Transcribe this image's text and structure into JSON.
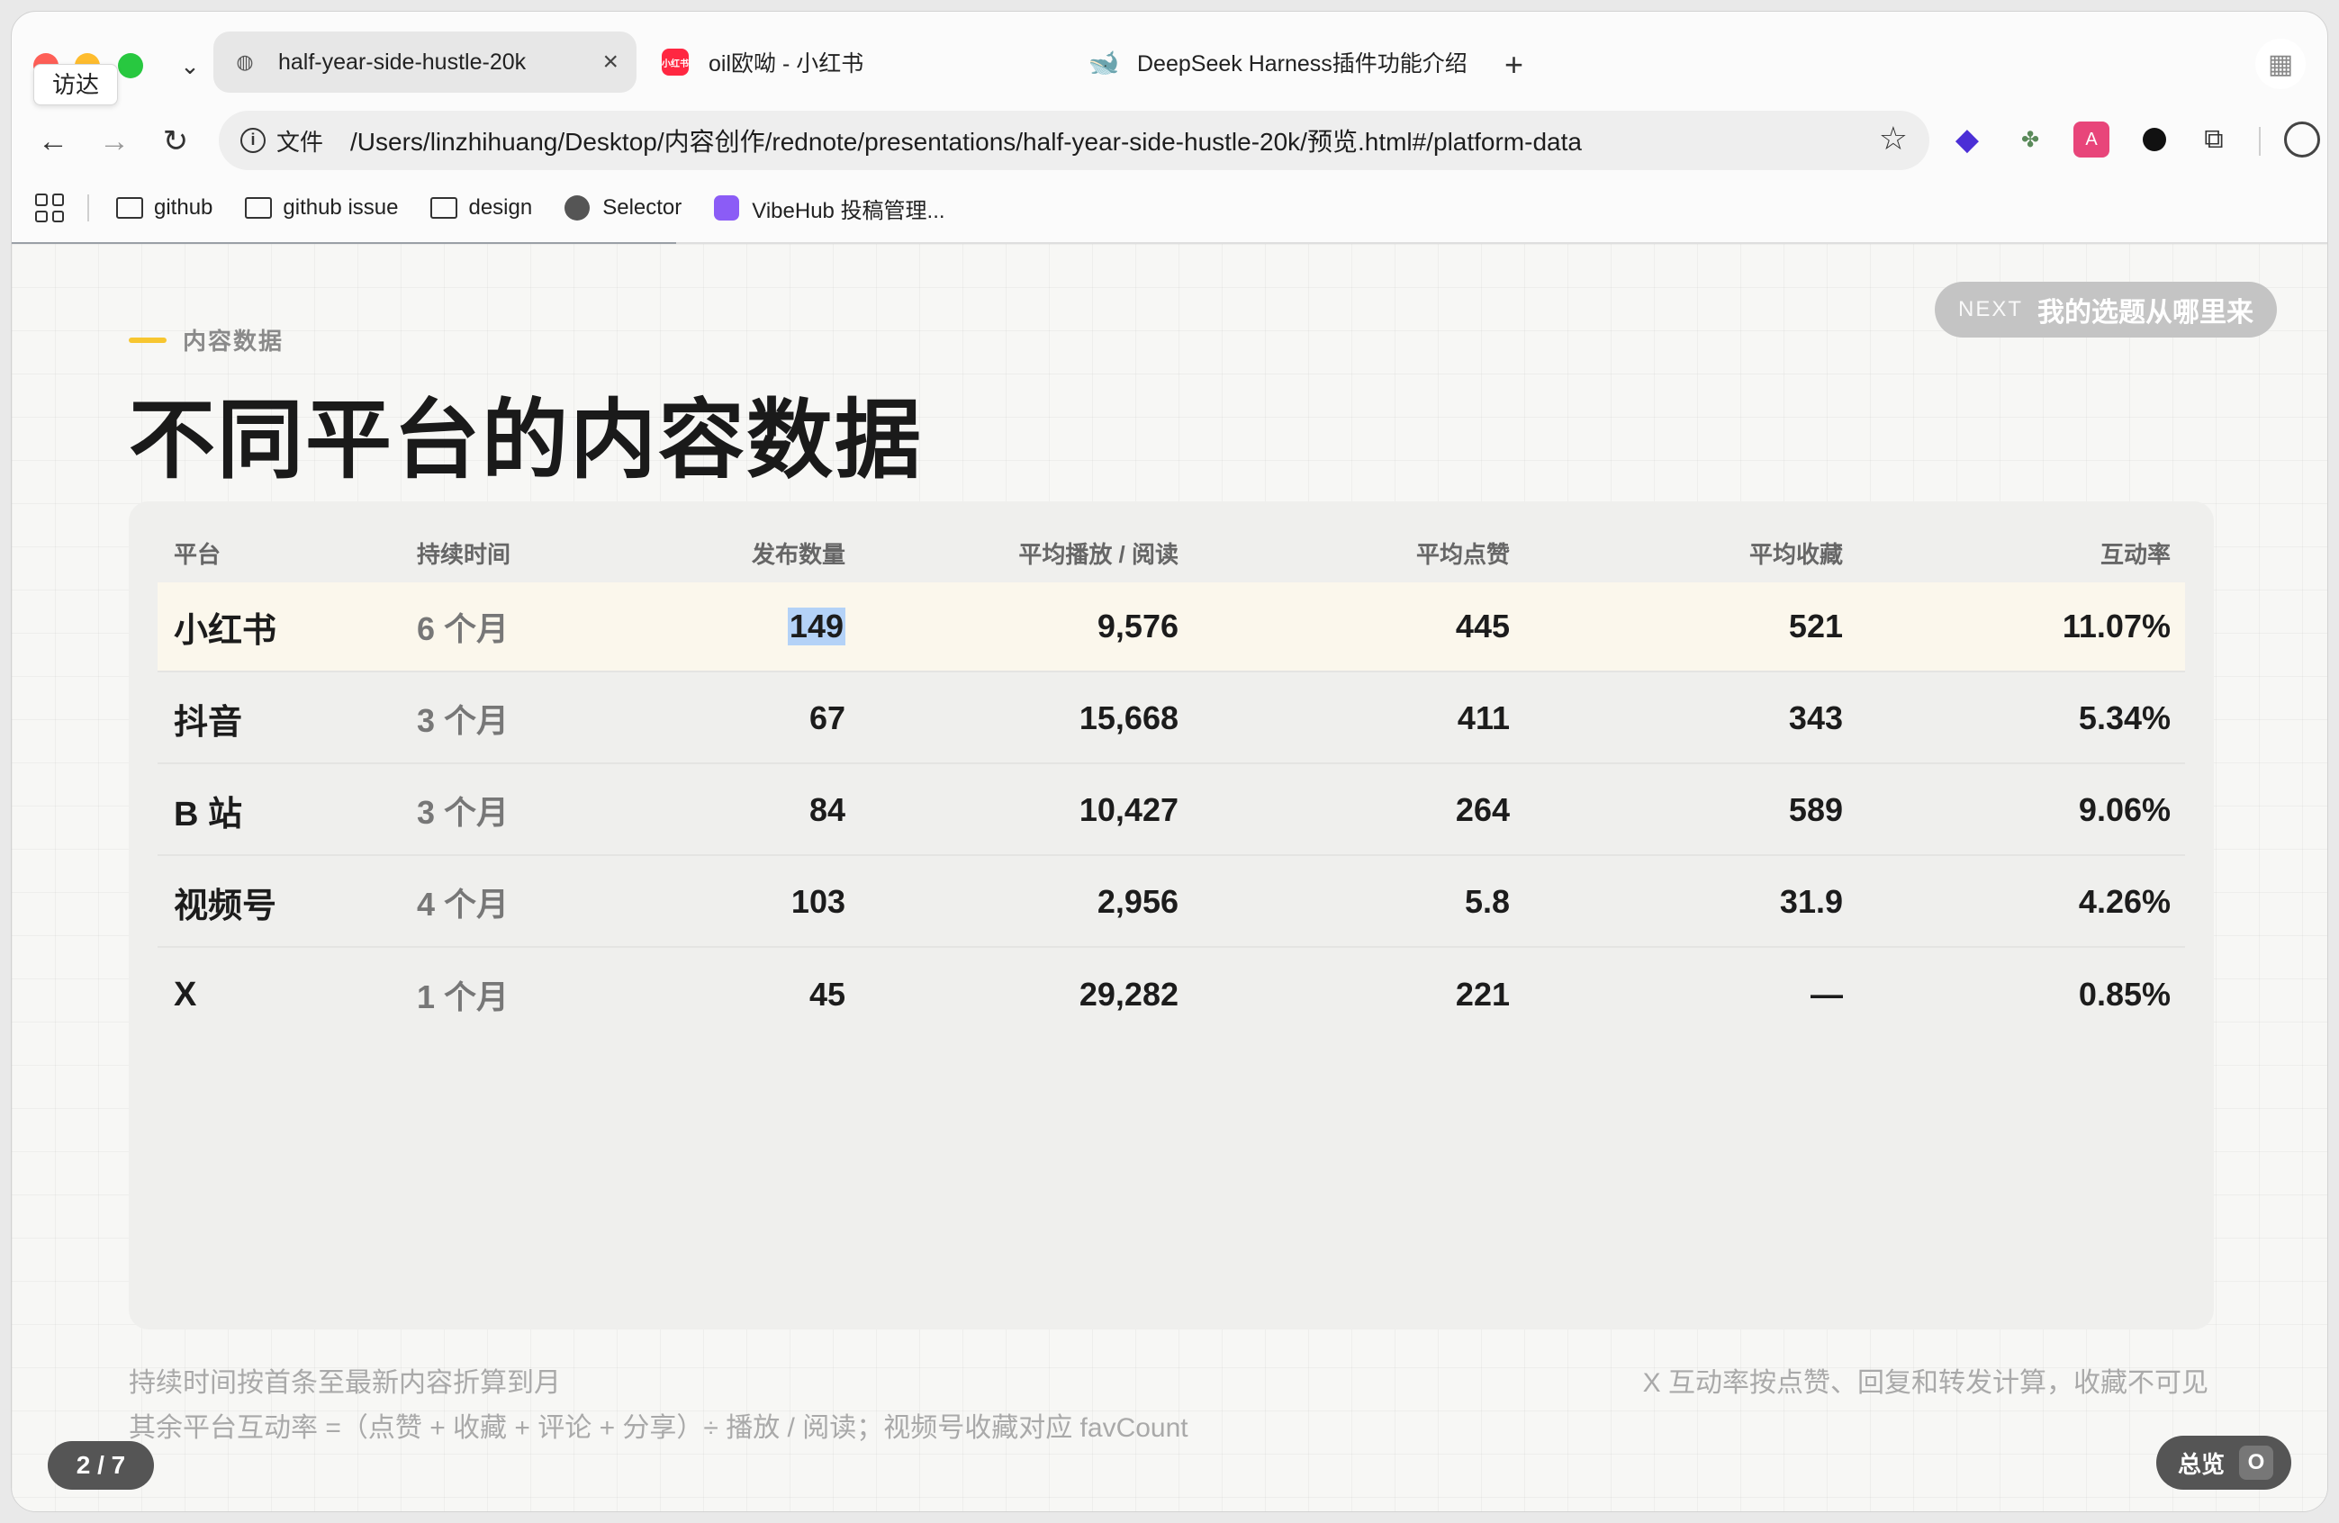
{
  "browser": {
    "tooltip": "访达",
    "tabs": [
      {
        "title": "half-year-side-hustle-20k",
        "icon": "globe-icon"
      },
      {
        "title": "oil欧呦 - 小红书",
        "icon": "xiaohongshu-icon"
      },
      {
        "title": "DeepSeek Harness插件功能介绍 -",
        "icon": "deepseek-icon"
      }
    ],
    "xhs_badge": "小红书",
    "address": {
      "scheme": "文件",
      "url": "/Users/linzhihuang/Desktop/内容创作/rednote/presentations/half-year-side-hustle-20k/预览.html#/platform-data"
    },
    "bookmarks": [
      {
        "label": "github",
        "icon": "folder-icon"
      },
      {
        "label": "github issue",
        "icon": "folder-icon"
      },
      {
        "label": "design",
        "icon": "folder-icon"
      },
      {
        "label": "Selector",
        "icon": "globe-icon"
      },
      {
        "label": "VibeHub 投稿管理...",
        "icon": "vibehub-icon"
      }
    ]
  },
  "slide": {
    "eyebrow": "内容数据",
    "title": "不同平台的内容数据",
    "next": {
      "tag": "NEXT",
      "label": "我的选题从哪里来"
    },
    "table": {
      "headers": [
        "平台",
        "持续时间",
        "发布数量",
        "平均播放 / 阅读",
        "平均点赞",
        "平均收藏",
        "互动率"
      ],
      "rows": [
        {
          "platform": "小红书",
          "duration": "6 个月",
          "posts": "149",
          "views": "9,576",
          "likes": "445",
          "saves": "521",
          "rate": "11.07%"
        },
        {
          "platform": "抖音",
          "duration": "3 个月",
          "posts": "67",
          "views": "15,668",
          "likes": "411",
          "saves": "343",
          "rate": "5.34%"
        },
        {
          "platform": "B 站",
          "duration": "3 个月",
          "posts": "84",
          "views": "10,427",
          "likes": "264",
          "saves": "589",
          "rate": "9.06%"
        },
        {
          "platform": "视频号",
          "duration": "4 个月",
          "posts": "103",
          "views": "2,956",
          "likes": "5.8",
          "saves": "31.9",
          "rate": "4.26%"
        },
        {
          "platform": "X",
          "duration": "1 个月",
          "posts": "45",
          "views": "29,282",
          "likes": "221",
          "saves": "—",
          "rate": "0.85%"
        }
      ]
    },
    "notes": {
      "left1": "持续时间按首条至最新内容折算到月",
      "left2": "其余平台互动率 =（点赞 + 收藏 + 评论 + 分享）÷ 播放 / 阅读；视频号收藏对应 favCount",
      "right": "X 互动率按点赞、回复和转发计算，收藏不可见"
    },
    "pager": "2 / 7",
    "overview": {
      "label": "总览",
      "key": "O"
    }
  }
}
